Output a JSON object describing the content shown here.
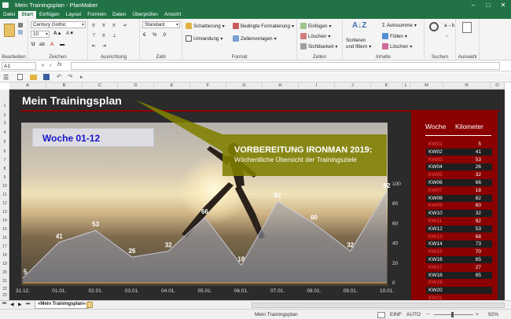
{
  "window": {
    "title": "Mein Trainingsplan - PlanMaker"
  },
  "tabs": [
    "Datei",
    "Start",
    "Einfügen",
    "Layout",
    "Formeln",
    "Daten",
    "Überprüfen",
    "Ansicht"
  ],
  "ribbon": {
    "font_name": "Century Gothic",
    "font_size": "10",
    "number_format": "Standard",
    "format": {
      "schattierung": "Schattierung",
      "umrandung": "Umrandung",
      "bedingte": "Bedingte Formatierung",
      "zellenvorlagen": "Zellenvorlagen"
    },
    "zellen": {
      "einfuegen": "Einfügen",
      "loeschen": "Löschen",
      "sichtbarkeit": "Sichtbarkeit"
    },
    "inhalte": {
      "sort1": "Sortieren",
      "sort2": "und filtern",
      "autosumme": "Autosumme",
      "fuellen": "Füllen",
      "loeschen": "Löschen"
    },
    "groups": {
      "bearbeiten": "Bearbeiten",
      "zeichen": "Zeichen",
      "ausrichtung": "Ausrichtung",
      "zahl": "Zahl",
      "format": "Format",
      "zellen": "Zellen",
      "inhalte": "Inhalte",
      "suchen": "Suchen",
      "auswahl": "Auswahl"
    }
  },
  "formula_bar": {
    "cell_ref": "A1",
    "fx": "fx",
    "value": ""
  },
  "columns": [
    "A",
    "B",
    "C",
    "D",
    "E",
    "F",
    "G",
    "H",
    "I",
    "J",
    "K",
    "L",
    "M",
    "N",
    "O"
  ],
  "rows": [
    "1",
    "2",
    "3",
    "4",
    "5",
    "6",
    "7",
    "8",
    "9",
    "10",
    "11",
    "12",
    "13",
    "14",
    "15",
    "16",
    "17",
    "18",
    "19",
    "20",
    "21",
    "22",
    "23",
    "24"
  ],
  "sheet": {
    "title": "Mein Trainingsplan",
    "woche_label": "Woche 01-12",
    "callout_line1": "VORBEREITUNG IRONMAN 2019:",
    "callout_line2": "Wöchentliche Übersicht der Trainingsziele"
  },
  "chart_data": {
    "type": "area",
    "x": [
      "31.12.",
      "01.01.",
      "02.01.",
      "03.01.",
      "04.01.",
      "05.01.",
      "06.01.",
      "07.01.",
      "08.01.",
      "09.01.",
      "10.01."
    ],
    "values": [
      5,
      41,
      53,
      26,
      32,
      66,
      18,
      82,
      60,
      32,
      92
    ],
    "y_ticks": [
      0,
      20,
      40,
      60,
      80,
      100
    ],
    "ylim": [
      0,
      100
    ]
  },
  "table": {
    "header_woche": "Woche",
    "header_km": "Kilometer",
    "rows": [
      {
        "kw": "KW01",
        "km": "5"
      },
      {
        "kw": "KW02",
        "km": "41"
      },
      {
        "kw": "KW03",
        "km": "53"
      },
      {
        "kw": "KW04",
        "km": "26"
      },
      {
        "kw": "KW05",
        "km": "32"
      },
      {
        "kw": "KW06",
        "km": "66"
      },
      {
        "kw": "KW07",
        "km": "18"
      },
      {
        "kw": "KW08",
        "km": "82"
      },
      {
        "kw": "KW09",
        "km": "60"
      },
      {
        "kw": "KW10",
        "km": "32"
      },
      {
        "kw": "KW11",
        "km": "92"
      },
      {
        "kw": "KW12",
        "km": "53"
      },
      {
        "kw": "KW13",
        "km": "68"
      },
      {
        "kw": "KW14",
        "km": "73"
      },
      {
        "kw": "KW15",
        "km": "70"
      },
      {
        "kw": "KW16",
        "km": "65"
      },
      {
        "kw": "KW17",
        "km": "27"
      },
      {
        "kw": "KW18",
        "km": "85"
      },
      {
        "kw": "KW19",
        "km": ""
      },
      {
        "kw": "KW20",
        "km": ""
      },
      {
        "kw": "KW21",
        "km": ""
      }
    ],
    "colors": {
      "dark_row": "#1e1e1e",
      "red_row": "#8b0000",
      "highlight_text": "#ff5555"
    }
  },
  "sheet_tab": "«Mein Trainingsplan»",
  "status": {
    "sheet_name": "Mein Trainingsplan",
    "mode1": "EINF",
    "mode2": "AUTO",
    "zoom": "92%"
  }
}
